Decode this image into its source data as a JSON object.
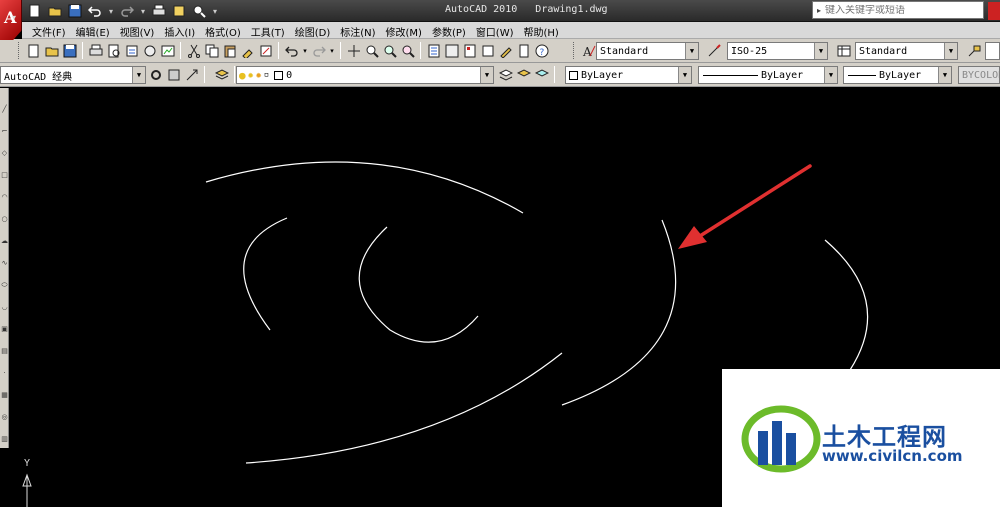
{
  "window": {
    "title": "AutoCAD 2010   Drawing1.dwg",
    "search_placeholder": "键入关键字或短语"
  },
  "menu": {
    "items": [
      {
        "label": "文件(F)"
      },
      {
        "label": "编辑(E)"
      },
      {
        "label": "视图(V)"
      },
      {
        "label": "插入(I)"
      },
      {
        "label": "格式(O)"
      },
      {
        "label": "工具(T)"
      },
      {
        "label": "绘图(D)"
      },
      {
        "label": "标注(N)"
      },
      {
        "label": "修改(M)"
      },
      {
        "label": "参数(P)"
      },
      {
        "label": "窗口(W)"
      },
      {
        "label": "帮助(H)"
      }
    ]
  },
  "styles": {
    "text_style": "Standard",
    "dim_style": "ISO-25",
    "table_style": "Standard"
  },
  "workspace": {
    "name": "AutoCAD 经典",
    "layer": "0"
  },
  "properties": {
    "color": "ByLayer",
    "linetype": "ByLayer",
    "lineweight": "ByLayer",
    "plotstyle": "BYCOLOR"
  },
  "ucs": {
    "y_label": "Y"
  },
  "watermark": {
    "brand": "土木工程网",
    "url": "www.civilcn.com"
  },
  "colors": {
    "canvas_bg": "#000000",
    "arc_color": "#ffffff",
    "arrow_color": "#e03030",
    "toolbar_bg": "#d4d0c8",
    "brand_blue": "#1a4fa0",
    "brand_green": "#6cbb2a"
  }
}
